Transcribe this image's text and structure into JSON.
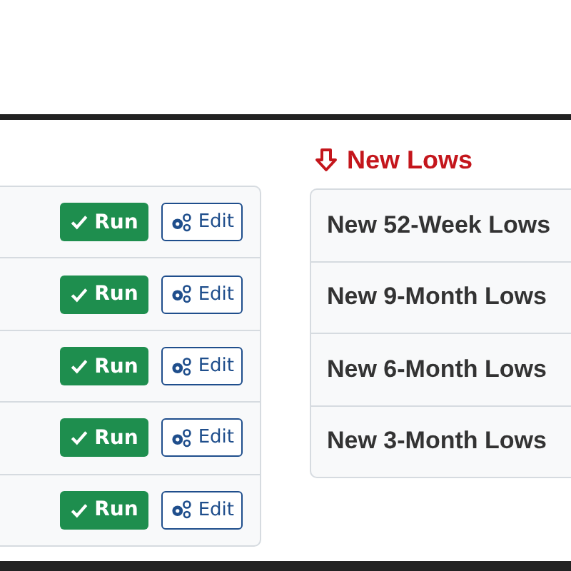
{
  "screens": [
    {
      "run_label": "Run",
      "edit_label": "Edit"
    },
    {
      "run_label": "Run",
      "edit_label": "Edit"
    },
    {
      "run_label": "Run",
      "edit_label": "Edit"
    },
    {
      "run_label": "Run",
      "edit_label": "Edit"
    },
    {
      "run_label": "Run",
      "edit_label": "Edit"
    }
  ],
  "new_lows": {
    "heading": "New Lows",
    "items": [
      "New 52-Week Lows",
      "New 9-Month Lows",
      "New 6-Month Lows",
      "New 3-Month Lows"
    ]
  }
}
